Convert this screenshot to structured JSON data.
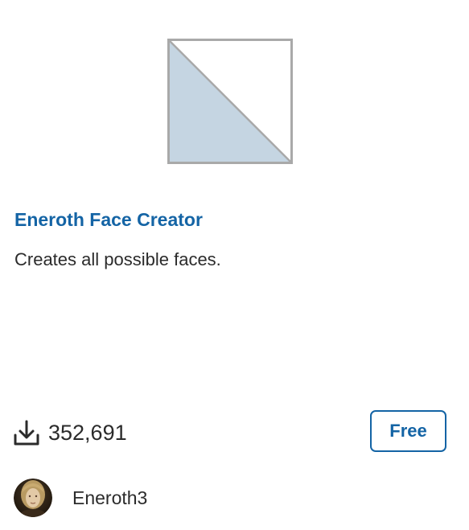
{
  "extension": {
    "title": "Eneroth Face Creator",
    "description": "Creates all possible faces.",
    "downloads": "352,691",
    "price_label": "Free",
    "author_name": "Eneroth3"
  },
  "icons": {
    "thumbnail": "placeholder-thumbnail-icon",
    "downloads": "download-icon",
    "avatar": "author-avatar"
  },
  "colors": {
    "title": "#1464a5",
    "button": "#1464a5",
    "text": "#2b2b2b",
    "thumbnail_fill": "#c5d5e2",
    "thumbnail_border": "#a9a9a9"
  }
}
